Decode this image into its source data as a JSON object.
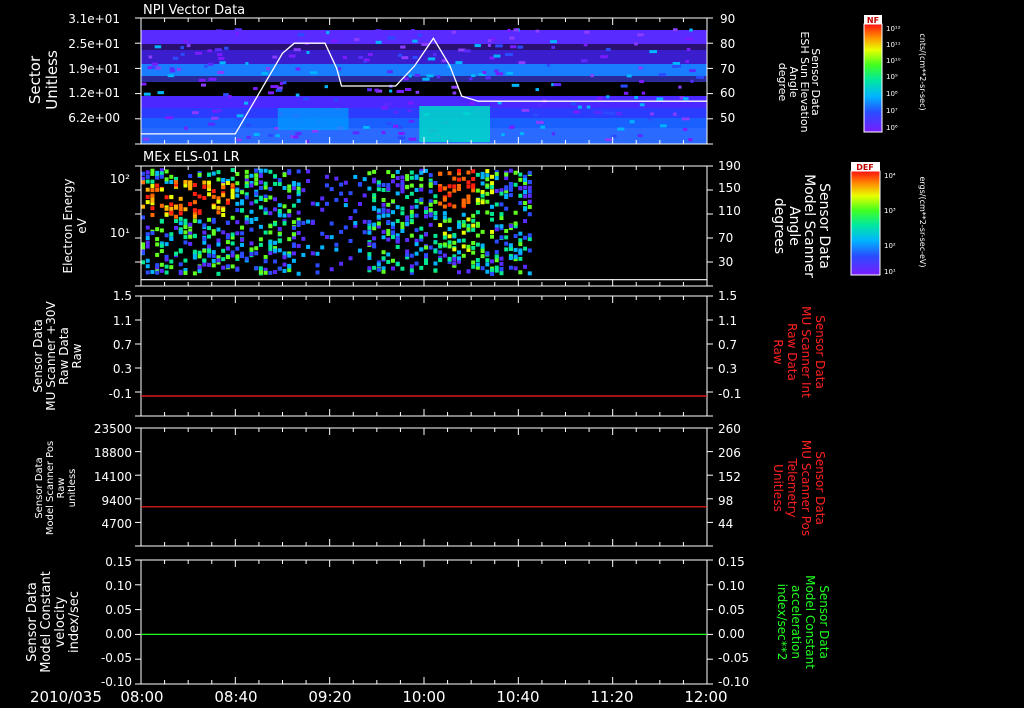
{
  "date_label": "2010/035",
  "time_ticks": [
    "08:00",
    "08:40",
    "09:20",
    "10:00",
    "10:40",
    "11:20",
    "12:00"
  ],
  "time_range": [
    0,
    240
  ],
  "panels": [
    {
      "title": "NPI Vector Data",
      "left_label": [
        "Sector",
        "Unitless"
      ],
      "left_ticks": [
        "3.1e+01",
        "2.5e+01",
        "1.9e+01",
        "1.2e+01",
        "6.2e+00"
      ],
      "right_label": [
        "Sensor Data",
        "ESH Sun Elevation",
        "Angle",
        "degree"
      ],
      "right_ticks": [
        "90",
        "80",
        "70",
        "60",
        "50"
      ],
      "colorbar": {
        "tag": "NF",
        "unit": "cnts/(cm**2-sr-sec)",
        "ticks": [
          "10¹²",
          "10¹¹",
          "10¹⁰",
          "10⁹",
          "10⁸",
          "10⁷",
          "10⁶"
        ]
      }
    },
    {
      "title": "MEx ELS-01 LR",
      "left_label": [
        "Electron Energy",
        "eV"
      ],
      "left_ticks": [
        "10²",
        "10¹"
      ],
      "right_label": [
        "Sensor Data",
        "Model Scanner",
        "Angle",
        "degrees"
      ],
      "right_ticks": [
        "190",
        "150",
        "110",
        "70",
        "30"
      ],
      "colorbar": {
        "tag": "DEF",
        "unit": "ergs/(cm**2-sr-sec-eV)",
        "ticks": [
          "10⁴",
          "10³",
          "10²",
          "10¹"
        ]
      }
    },
    {
      "left_label": [
        "Sensor Data",
        "MU Scanner +30V",
        "Raw Data",
        "Raw"
      ],
      "left_ticks": [
        "1.5",
        "1.1",
        "0.7",
        "0.3",
        "-0.1"
      ],
      "right_label": [
        "Sensor Data",
        "MU Scanner Int",
        "Raw Data",
        "Raw"
      ],
      "right_ticks": [
        "1.5",
        "1.1",
        "0.7",
        "0.3",
        "-0.1"
      ]
    },
    {
      "left_label": [
        "Sensor Data",
        "Model Scanner Pos",
        "Raw",
        "unitless"
      ],
      "left_ticks": [
        "23500",
        "18800",
        "14100",
        "9400",
        "4700"
      ],
      "right_label": [
        "Sensor Data",
        "MU Scanner Pos",
        "Telemetry",
        "Unitless"
      ],
      "right_ticks": [
        "260",
        "206",
        "152",
        "98",
        "44"
      ]
    },
    {
      "left_label": [
        "Sensor Data",
        "Model Constant",
        "velocity",
        "index/sec"
      ],
      "left_ticks": [
        "0.15",
        "0.10",
        "0.05",
        "0.00",
        "-0.05",
        "-0.10"
      ],
      "right_label": [
        "Sensor Data",
        "Model Constant",
        "acceleration",
        "index/sec**2"
      ],
      "right_ticks": [
        "0.15",
        "0.10",
        "0.05",
        "0.00",
        "-0.05",
        "-0.10"
      ]
    }
  ],
  "chart_data": [
    {
      "type": "heatmap",
      "title": "NPI Vector Data",
      "x_unit": "minutes since 08:00",
      "y_left": "Sector (Unitless)",
      "y_right": "Sensor Data ESH Sun Elevation Angle (degree)",
      "xlim": [
        0,
        240
      ],
      "ylim_right": [
        40,
        90
      ],
      "sun_elevation_line": {
        "x": [
          0,
          40,
          50,
          60,
          65,
          78,
          83,
          85,
          108,
          116,
          124,
          131,
          136,
          143,
          240
        ],
        "y": [
          44,
          44,
          60,
          76,
          80,
          80,
          70,
          63,
          63,
          71,
          82,
          71,
          59,
          57,
          57
        ]
      }
    },
    {
      "type": "heatmap",
      "title": "MEx ELS-01 LR",
      "x_unit": "minutes since 08:00",
      "y_left": "Electron Energy (eV)",
      "y_right": "Sensor Data Model Scanner Angle (degrees)",
      "xlim": [
        0,
        240
      ],
      "ylim_right": [
        0,
        190
      ],
      "scanner_angle_line": {
        "x": [
          0,
          240
        ],
        "y": [
          10,
          10
        ]
      }
    },
    {
      "type": "line",
      "y_left": "Sensor Data MU Scanner +30V Raw Data (Raw)",
      "y_right": "Sensor Data MU Scanner Int Raw Data (Raw)",
      "xlim": [
        0,
        240
      ],
      "ylim": [
        -0.3,
        1.5
      ],
      "series": [
        {
          "color": "#ff2020",
          "x": [
            0,
            240
          ],
          "y": [
            0.0,
            0.0
          ]
        }
      ]
    },
    {
      "type": "line",
      "y_left": "Sensor Data Model Scanner Pos Raw (unitless)",
      "y_right": "Sensor Data MU Scanner Pos Telemetry (Unitless)",
      "xlim": [
        0,
        240
      ],
      "ylim": [
        0,
        23500
      ],
      "series": [
        {
          "color": "#ff2020",
          "x": [
            0,
            240
          ],
          "y": [
            7800,
            7800
          ]
        }
      ]
    },
    {
      "type": "line",
      "y_left": "Sensor Data Model Constant velocity (index/sec)",
      "y_right": "Sensor Data Model Constant acceleration (index/sec**2)",
      "xlim": [
        0,
        240
      ],
      "ylim": [
        -0.1,
        0.15
      ],
      "series": [
        {
          "color": "#20ff20",
          "x": [
            0,
            240
          ],
          "y": [
            0.0,
            0.0
          ]
        }
      ]
    }
  ],
  "colors": {
    "axis": "#ffffff",
    "red_label": "#ff2020",
    "green_label": "#20ff20",
    "trace_white": "#ffffff"
  }
}
